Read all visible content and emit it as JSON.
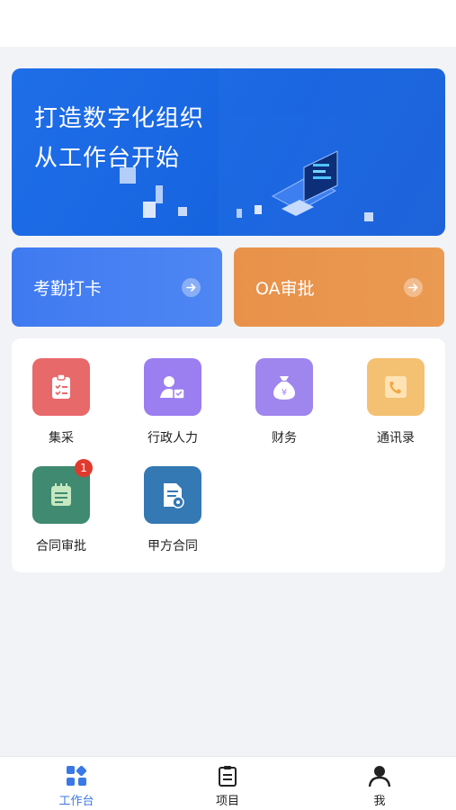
{
  "banner": {
    "line1": "打造数字化组织",
    "line2": "从工作台开始"
  },
  "quick": [
    {
      "label": "考勤打卡",
      "color": "#4a80f2"
    },
    {
      "label": "OA审批",
      "color": "#e9954d"
    }
  ],
  "apps": [
    {
      "label": "集采",
      "icon": "clipboard-check-icon",
      "color": "#e8696a"
    },
    {
      "label": "行政人力",
      "icon": "person-card-icon",
      "color": "#9b7ef0"
    },
    {
      "label": "财务",
      "icon": "money-bag-icon",
      "color": "#9f85ee"
    },
    {
      "label": "通讯录",
      "icon": "phone-book-icon",
      "color": "#f4c072"
    },
    {
      "label": "合同审批",
      "icon": "notepad-icon",
      "color": "#3f8a70",
      "badge": "1"
    },
    {
      "label": "甲方合同",
      "icon": "document-gear-icon",
      "color": "#3478b4"
    }
  ],
  "tabbar": [
    {
      "label": "工作台",
      "icon": "grid-icon",
      "active": true
    },
    {
      "label": "项目",
      "icon": "clipboard-icon",
      "active": false
    },
    {
      "label": "我",
      "icon": "user-icon",
      "active": false
    }
  ]
}
